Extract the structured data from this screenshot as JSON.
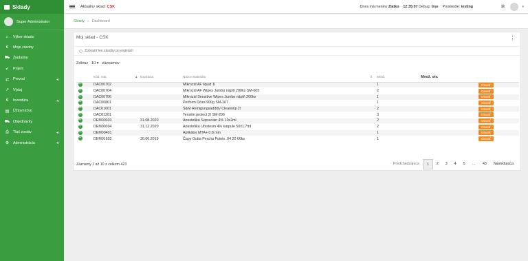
{
  "app": {
    "brand": "Sklady"
  },
  "user": {
    "name": "Super Administrator"
  },
  "sidebar": {
    "items": [
      {
        "label": "Výber skladu",
        "icon": "store-icon",
        "glyph": "⌂",
        "arrow": ""
      },
      {
        "label": "Moje zásoby",
        "icon": "euro-icon",
        "glyph": "€",
        "arrow": ""
      },
      {
        "label": "Žiadanky",
        "icon": "cart-icon",
        "glyph": "⛟",
        "arrow": ""
      },
      {
        "label": "Príjem",
        "icon": "arrow-in-icon",
        "glyph": "↙",
        "arrow": ""
      },
      {
        "label": "Prevod",
        "icon": "truck-icon",
        "glyph": "⇄",
        "arrow": "◂"
      },
      {
        "label": "Výdaj",
        "icon": "arrow-out-icon",
        "glyph": "↗",
        "arrow": ""
      },
      {
        "label": "Inventúra",
        "icon": "euro-icon",
        "glyph": "€",
        "arrow": "◂"
      },
      {
        "label": "Účtovníctvo",
        "icon": "ledger-icon",
        "glyph": "▤",
        "arrow": ""
      },
      {
        "label": "Objednávky",
        "icon": "cart-icon",
        "glyph": "⛟",
        "arrow": ""
      },
      {
        "label": "Tlač zostáv",
        "icon": "print-icon",
        "glyph": "⎙",
        "arrow": "◂"
      },
      {
        "label": "Administrácia",
        "icon": "gear-icon",
        "glyph": "⚙",
        "arrow": "◂"
      }
    ]
  },
  "topbar": {
    "store_label": "Aktuálny sklad:",
    "store_value": "CSK",
    "info_prefix": "Dnes má meniny",
    "name_day": "Zlatko",
    "time": "12:35:07",
    "debug_label": "Debug:",
    "debug_value": "true",
    "env_label": "Prostredie:",
    "env_value": "testing"
  },
  "breadcrumb": {
    "root": "Sklady",
    "sep": "»",
    "current": "Dashboard"
  },
  "card": {
    "title": "Moj sklad - CSK",
    "kebab": "⋮",
    "toggle_label": "Zobraziť len zásoby po expirácií",
    "length_prefix": "Zobraz",
    "length_value": "10",
    "length_caret": "▾",
    "length_suffix": "záznamov"
  },
  "table": {
    "headers": {
      "code": "Kód. mat.",
      "sort": "▲",
      "exp": "Expirácia",
      "name": "Názov Materiálu",
      "sort2": "⇕",
      "qty": "Množ.",
      "qty_other": "Množ. otv."
    },
    "button_label": "Otvoriť",
    "rows": [
      {
        "code": "DAC00702",
        "exp": "",
        "name": "Mikrozid AF liquid 1l",
        "qty": "1"
      },
      {
        "code": "DAC00704",
        "exp": "",
        "name": "Mikrozid AF Wipes Jumbo náplň 200ks SM-605",
        "qty": "2"
      },
      {
        "code": "DAC00706",
        "exp": "",
        "name": "Mikrozid Sensitive Wipes Jumbo náplň 200ks",
        "qty": "1"
      },
      {
        "code": "DAC00801",
        "exp": "",
        "name": "Perform Dóza 900g  SM-107",
        "qty": "1"
      },
      {
        "code": "DAC01001",
        "exp": "",
        "name": "S&M Reinigungsadditiv Cleanniqi 2l",
        "qty": "2"
      },
      {
        "code": "DAC01201",
        "exp": "",
        "name": "Tensilin protect 2l SM-206",
        "qty": "3"
      },
      {
        "code": "DEM00303",
        "exp": "31.08.2020",
        "name": "Anestetiká Supracain 4% 10x2ml",
        "qty": "2"
      },
      {
        "code": "DEM00304",
        "exp": "31.12.2020",
        "name": "Anestetiká Ubistesin 4% karpule 50x1.7ml",
        "qty": "2"
      },
      {
        "code": "DEM00401",
        "exp": "",
        "name": "Aplikátor MTA+ 0.8 mm",
        "qty": "1"
      },
      {
        "code": "DEM01602",
        "exp": "30.06.2019",
        "name": "Čapy Gutta Percha Points .04 20 60ks",
        "qty": "1"
      }
    ]
  },
  "footer": {
    "info": "Záznamy 1 až 10 z celkom 423",
    "prev": "Predchádzajúca",
    "pages": [
      "1",
      "2",
      "3",
      "4",
      "5",
      "…",
      "43"
    ],
    "next": "Nasledujúca"
  }
}
